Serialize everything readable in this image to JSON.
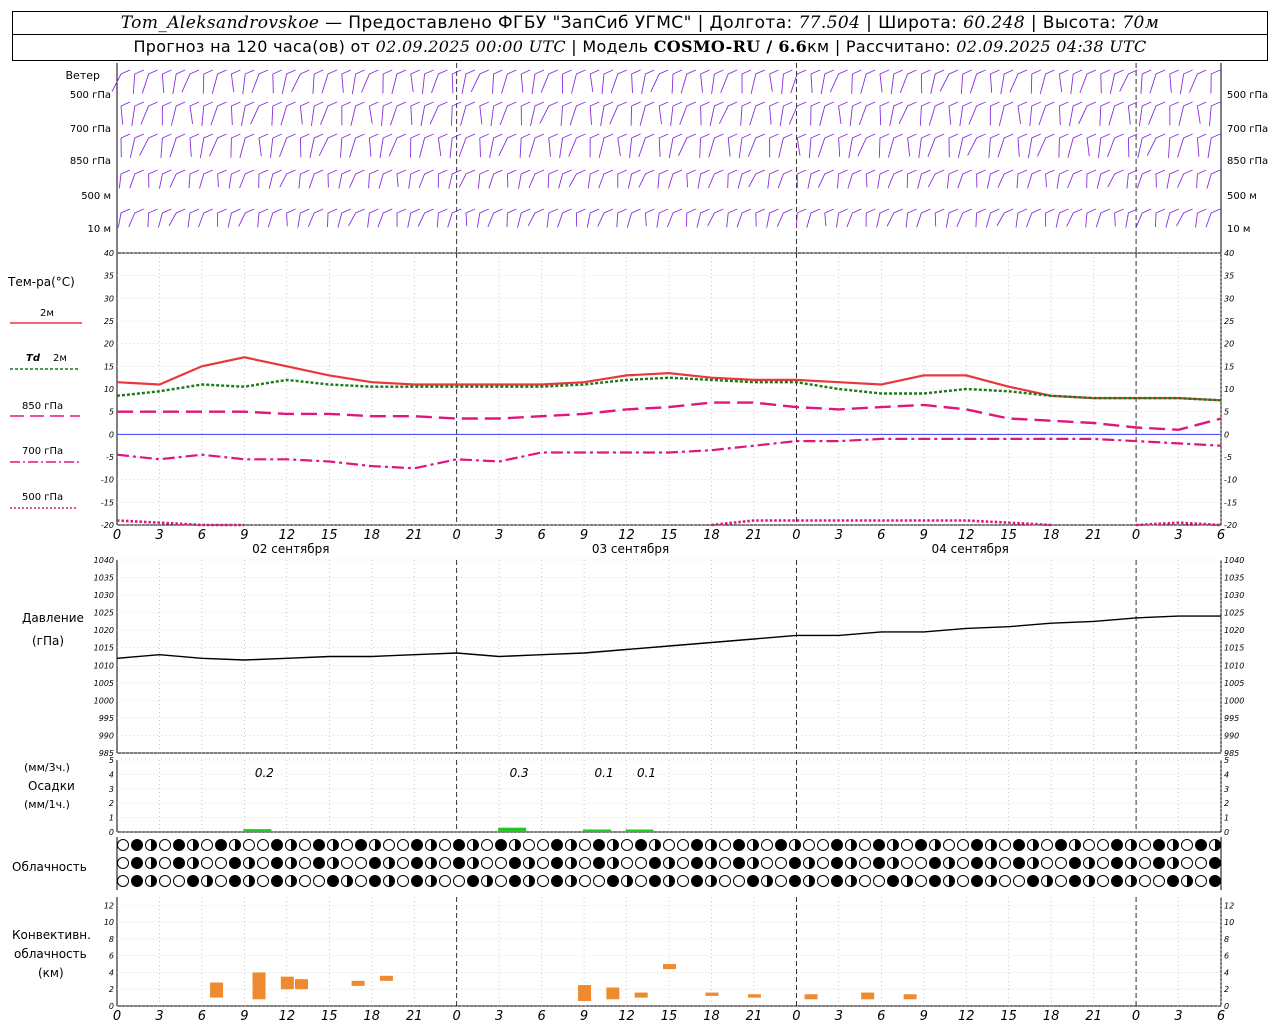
{
  "header": {
    "station": "Tom_Aleksandrovskoe",
    "provided_by": " — Предоставлено ФГБУ \"ЗапСиб УГМС\" | Долгота: ",
    "lon": "77.504",
    "lat_label": " | Широта: ",
    "lat": "60.248",
    "alt_label": " | Высота: ",
    "alt": "70м"
  },
  "header2": {
    "forecast_prefix": "Прогноз на 120 часа(ов) от ",
    "start": "02.09.2025 00:00 UTC",
    "model_label": "  | Модель ",
    "model": "COSMO-RU / 6.6",
    "model_unit": "км",
    "calc_label": " | Рассчитано: ",
    "calc": "02.09.2025 04:38 UTC"
  },
  "wind_labels": {
    "title": "Ветер",
    "levels": [
      "500 гПа",
      "700 гПа",
      "850 гПа",
      "500 м",
      "10 м"
    ]
  },
  "temp_labels": {
    "title": "Тем-ра(°С)",
    "l2m": "2м",
    "td_a": "Td",
    "td_b": "2м",
    "l850": "850 гПа",
    "l700": "700 гПа",
    "l500": "500 гПа"
  },
  "pressure_labels": {
    "a": "Давление",
    "b": "(гПа)"
  },
  "precip_labels": {
    "a": "(мм/3ч.)",
    "b": "Осадки",
    "c": "(мм/1ч.)"
  },
  "cloud_label": "Облачность",
  "conv_labels": {
    "a": "Конвективн.",
    "b": "облачность",
    "c": "(км)"
  },
  "time_ticks": [
    "0",
    "3",
    "6",
    "9",
    "12",
    "15",
    "18",
    "21",
    "0",
    "3",
    "6",
    "9",
    "12",
    "15",
    "18",
    "21",
    "0",
    "3",
    "6",
    "9",
    "12",
    "15",
    "18",
    "21",
    "0",
    "3",
    "6"
  ],
  "date_labels": [
    "02 сентября",
    "03 сентября",
    "04 сентября"
  ],
  "colors": {
    "wind": "#8a2be2",
    "t2m": "#e8383d",
    "td": "#1a7a1a",
    "upper": "#e0157f",
    "precip": "#22c822",
    "conv": "#f08a30",
    "zero": "#3a3aff"
  },
  "chart_data": [
    {
      "type": "line",
      "panel": "temperature",
      "title": "Тем-ра(°С)",
      "ylim": [
        -20,
        40
      ],
      "yticks": [
        40,
        35,
        30,
        25,
        20,
        15,
        10,
        5,
        0,
        -5,
        -10,
        -15,
        -20
      ],
      "x_hours": [
        0,
        3,
        6,
        9,
        12,
        15,
        18,
        21,
        24,
        27,
        30,
        33,
        36,
        39,
        42,
        45,
        48,
        51,
        54,
        57,
        60,
        63,
        66,
        69,
        72,
        75,
        78
      ],
      "series": [
        {
          "name": "2м",
          "values": [
            11.5,
            11.0,
            15.0,
            17.0,
            15.0,
            13.0,
            11.5,
            11.0,
            11.0,
            11.0,
            11.0,
            11.5,
            13.0,
            13.5,
            12.5,
            12.0,
            12.0,
            11.5,
            11.0,
            13.0,
            13.0,
            10.5,
            8.5,
            8.0,
            8.0,
            8.0,
            7.5
          ]
        },
        {
          "name": "Td 2м",
          "values": [
            8.5,
            9.5,
            11.0,
            10.5,
            12.0,
            11.0,
            10.5,
            10.5,
            10.5,
            10.5,
            10.5,
            11.0,
            12.0,
            12.5,
            12.0,
            11.5,
            11.5,
            10.0,
            9.0,
            9.0,
            10.0,
            9.5,
            8.5,
            8.0,
            8.0,
            8.0,
            7.5
          ]
        },
        {
          "name": "850 гПа",
          "values": [
            5.0,
            5.0,
            5.0,
            5.0,
            4.5,
            4.5,
            4.0,
            4.0,
            3.5,
            3.5,
            4.0,
            4.5,
            5.5,
            6.0,
            7.0,
            7.0,
            6.0,
            5.5,
            6.0,
            6.5,
            5.5,
            3.5,
            3.0,
            2.5,
            1.5,
            1.0,
            3.5
          ]
        },
        {
          "name": "700 гПа",
          "values": [
            -4.5,
            -5.5,
            -4.5,
            -5.5,
            -5.5,
            -6.0,
            -7.0,
            -7.5,
            -5.5,
            -6.0,
            -4.0,
            -4.0,
            -4.0,
            -4.0,
            -3.5,
            -2.5,
            -1.5,
            -1.5,
            -1.0,
            -1.0,
            -1.0,
            -1.0,
            -1.0,
            -1.0,
            -1.5,
            -2.0,
            -2.5
          ]
        },
        {
          "name": "500 гПа",
          "values": [
            -19,
            -19.5,
            -20,
            -20.5,
            null,
            null,
            null,
            null,
            null,
            null,
            null,
            null,
            null,
            null,
            -20,
            -19,
            -19,
            -19,
            -19,
            -19,
            -19,
            -19.5,
            -20,
            null,
            -20,
            -19.5,
            -20.5
          ]
        }
      ]
    },
    {
      "type": "line",
      "panel": "pressure",
      "title": "Давление",
      "ylabel": "(гПа)",
      "ylim": [
        985,
        1040
      ],
      "yticks": [
        1040,
        1035,
        1030,
        1025,
        1020,
        1015,
        1010,
        1005,
        1000,
        995,
        990,
        985
      ],
      "x_hours": [
        0,
        3,
        6,
        9,
        12,
        15,
        18,
        21,
        24,
        27,
        30,
        33,
        36,
        39,
        42,
        45,
        48,
        51,
        54,
        57,
        60,
        63,
        66,
        69,
        72,
        75,
        78
      ],
      "series": [
        {
          "name": "Давление",
          "values": [
            1012,
            1013,
            1012,
            1011.5,
            1012,
            1012.5,
            1012.5,
            1013,
            1013.5,
            1012.5,
            1013,
            1013.5,
            1014.5,
            1015.5,
            1016.5,
            1017.5,
            1018.5,
            1018.5,
            1019.5,
            1019.5,
            1020.5,
            1021,
            1022,
            1022.5,
            1023.5,
            1024,
            1024
          ]
        }
      ]
    },
    {
      "type": "bar",
      "panel": "precipitation",
      "title": "Осадки",
      "ylim": [
        0,
        5
      ],
      "yticks": [
        5,
        4,
        3,
        2,
        1,
        0
      ],
      "bars": [
        {
          "x_hours": 9,
          "value": 0.2,
          "label": "0.2"
        },
        {
          "x_hours": 27,
          "value": 0.3,
          "label": "0.3"
        },
        {
          "x_hours": 33,
          "value": 0.1,
          "label": "0.1"
        },
        {
          "x_hours": 36,
          "value": 0.1,
          "label": "0.1"
        }
      ]
    },
    {
      "type": "bar",
      "panel": "convective_cloud",
      "title": "Конвективн. облачность (км)",
      "ylim": [
        0,
        13
      ],
      "yticks": [
        12,
        10,
        8,
        6,
        4,
        2,
        0
      ],
      "bars": [
        {
          "x_hours": 7,
          "bottom": 1.0,
          "top": 2.8
        },
        {
          "x_hours": 10,
          "bottom": 0.8,
          "top": 4.0
        },
        {
          "x_hours": 12,
          "bottom": 2.0,
          "top": 3.5
        },
        {
          "x_hours": 13,
          "bottom": 2.0,
          "top": 3.2
        },
        {
          "x_hours": 17,
          "bottom": 2.4,
          "top": 3.0
        },
        {
          "x_hours": 19,
          "bottom": 3.0,
          "top": 3.6
        },
        {
          "x_hours": 33,
          "bottom": 0.6,
          "top": 2.5
        },
        {
          "x_hours": 35,
          "bottom": 0.8,
          "top": 2.2
        },
        {
          "x_hours": 37,
          "bottom": 1.0,
          "top": 1.6
        },
        {
          "x_hours": 39,
          "bottom": 4.4,
          "top": 5.0
        },
        {
          "x_hours": 42,
          "bottom": 1.2,
          "top": 1.6
        },
        {
          "x_hours": 45,
          "bottom": 1.0,
          "top": 1.4
        },
        {
          "x_hours": 49,
          "bottom": 0.8,
          "top": 1.4
        },
        {
          "x_hours": 53,
          "bottom": 0.8,
          "top": 1.6
        },
        {
          "x_hours": 56,
          "bottom": 0.8,
          "top": 1.4
        }
      ]
    }
  ]
}
